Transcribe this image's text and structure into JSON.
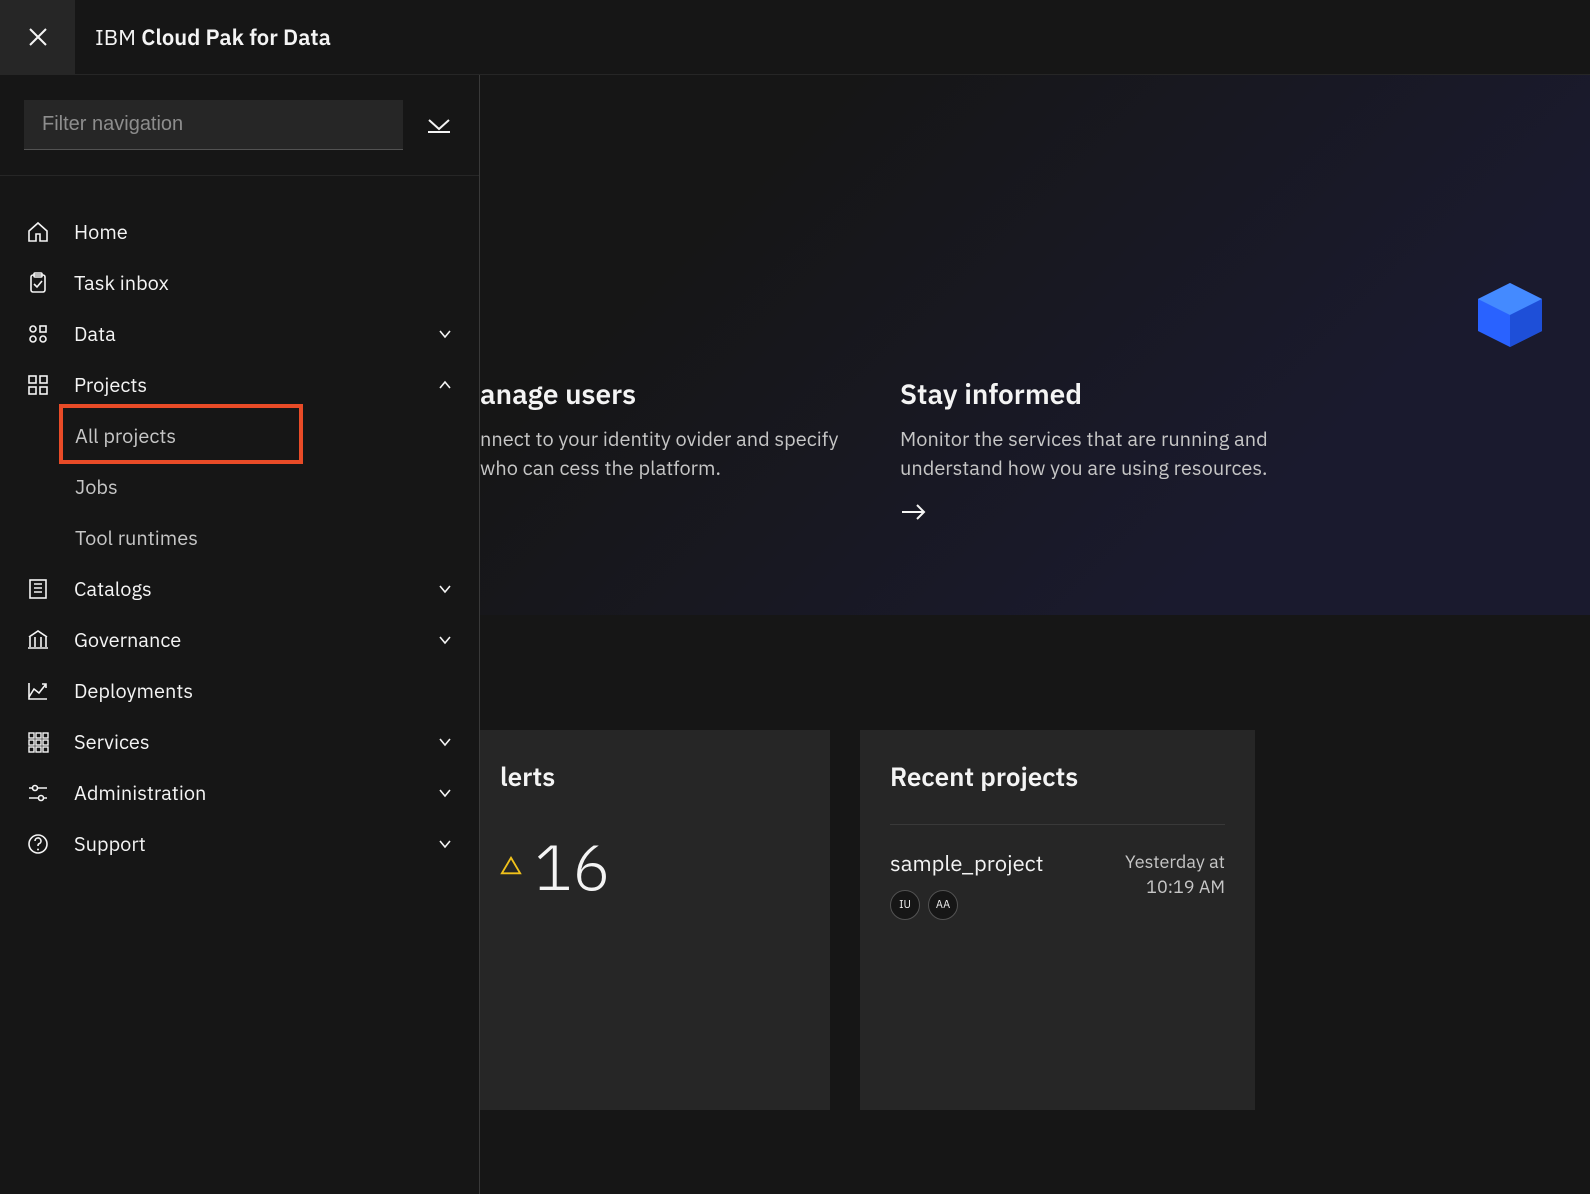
{
  "header": {
    "brand_prefix": "IBM ",
    "brand_bold": "Cloud Pak for Data"
  },
  "sidebar": {
    "filter_placeholder": "Filter navigation",
    "items": [
      {
        "label": "Home",
        "icon": "home",
        "expandable": false
      },
      {
        "label": "Task inbox",
        "icon": "task",
        "expandable": false
      },
      {
        "label": "Data",
        "icon": "data",
        "expandable": true,
        "expanded": false
      },
      {
        "label": "Projects",
        "icon": "projects",
        "expandable": true,
        "expanded": true,
        "children": [
          {
            "label": "All projects",
            "highlighted": true
          },
          {
            "label": "Jobs"
          },
          {
            "label": "Tool runtimes"
          }
        ]
      },
      {
        "label": "Catalogs",
        "icon": "catalogs",
        "expandable": true,
        "expanded": false
      },
      {
        "label": "Governance",
        "icon": "governance",
        "expandable": true,
        "expanded": false
      },
      {
        "label": "Deployments",
        "icon": "deployments",
        "expandable": false
      },
      {
        "label": "Services",
        "icon": "services",
        "expandable": true,
        "expanded": false
      },
      {
        "label": "Administration",
        "icon": "administration",
        "expandable": true,
        "expanded": false
      },
      {
        "label": "Support",
        "icon": "support",
        "expandable": true,
        "expanded": false
      }
    ]
  },
  "hero": {
    "cards": [
      {
        "title": "anage users",
        "body": "nnect to your identity ovider and specify who can cess the platform."
      },
      {
        "title": "Stay informed",
        "body": "Monitor the services that are running and understand how you are using resources."
      }
    ]
  },
  "alerts": {
    "title_fragment": "lerts",
    "count": "16"
  },
  "recent": {
    "title": "Recent projects",
    "items": [
      {
        "name": "sample_project",
        "time_line1": "Yesterday at",
        "time_line2": "10:19 AM",
        "avatars": [
          "IU",
          "AA"
        ]
      }
    ]
  }
}
